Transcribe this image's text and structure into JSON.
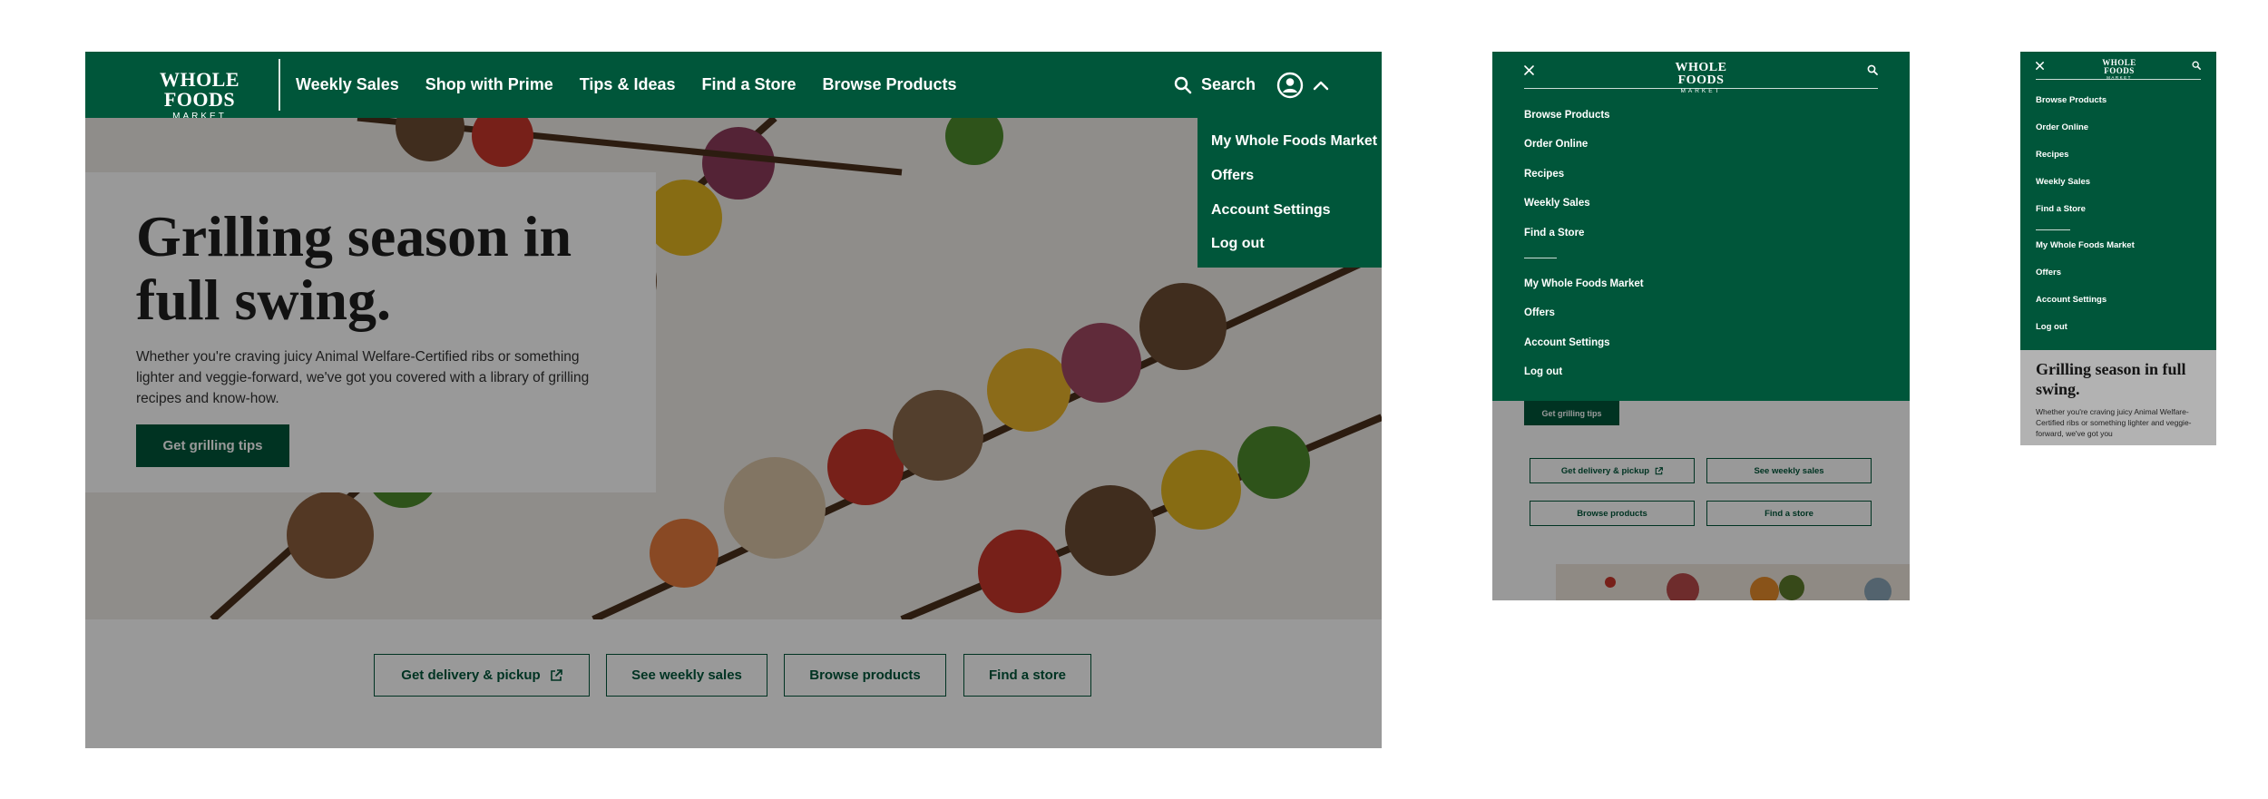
{
  "colors": {
    "brand_green": "#00563a",
    "text_dark": "#1e1e1e",
    "white": "#ffffff"
  },
  "brand": {
    "name_line1": "WHOLE FOODS",
    "name_line2": "MARKET"
  },
  "desktop": {
    "nav": [
      "Weekly Sales",
      "Shop with Prime",
      "Tips & Ideas",
      "Find a Store",
      "Browse Products"
    ],
    "search_label": "Search",
    "account_dropdown": [
      "My Whole Foods Market",
      "Offers",
      "Account Settings",
      "Log out"
    ],
    "hero": {
      "title": "Grilling season in full swing.",
      "body": "Whether you're craving juicy Animal Welfare-Certified ribs or something lighter and veggie-forward, we've got you covered with a library of grilling recipes and know-how.",
      "button": "Get grilling tips"
    },
    "ctas": [
      "Get delivery & pickup",
      "See weekly sales",
      "Browse products",
      "Find a store"
    ]
  },
  "tablet": {
    "menu_primary": [
      "Browse Products",
      "Order Online",
      "Recipes",
      "Weekly Sales",
      "Find a Store"
    ],
    "menu_account": [
      "My Whole Foods Market",
      "Offers",
      "Account Settings",
      "Log out"
    ],
    "hero_button": "Get grilling tips",
    "ctas": [
      "Get delivery & pickup",
      "See weekly sales",
      "Browse products",
      "Find a store"
    ]
  },
  "mobile": {
    "menu_primary": [
      "Browse Products",
      "Order Online",
      "Recipes",
      "Weekly Sales",
      "Find a Store"
    ],
    "menu_account": [
      "My Whole Foods Market",
      "Offers",
      "Account Settings",
      "Log out"
    ],
    "hero_title": "Grilling season in full swing.",
    "hero_body": "Whether you're craving juicy Animal Welfare-Certified ribs or something lighter and veggie-forward, we've got you"
  },
  "icons": [
    "search-icon",
    "account-icon",
    "chevron-up-icon",
    "close-icon",
    "external-link-icon"
  ]
}
